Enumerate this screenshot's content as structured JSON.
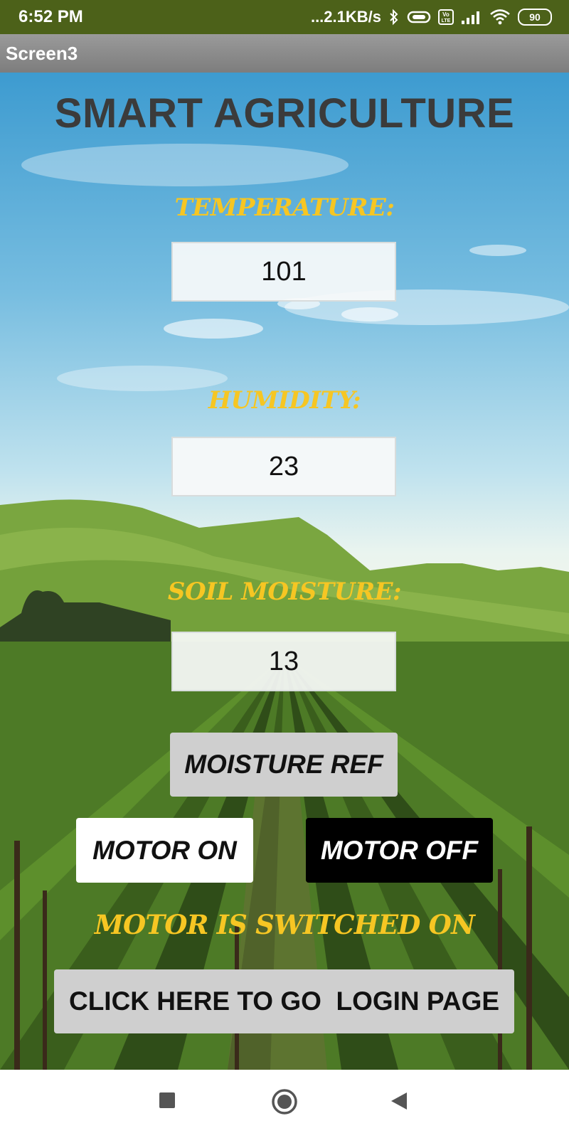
{
  "status_bar": {
    "time": "6:52 PM",
    "network_speed": "...2.1KB/s",
    "battery_level": "90",
    "icons": [
      "bluetooth-icon",
      "vibrate-icon",
      "volte-icon",
      "signal-icon",
      "wifi-icon",
      "battery-icon"
    ]
  },
  "title_bar": {
    "title": "Screen3"
  },
  "main": {
    "app_title": "SMART AGRICULTURE",
    "temperature": {
      "label": "TEMPERATURE:",
      "value": "101"
    },
    "humidity": {
      "label": "HUMIDITY:",
      "value": "23"
    },
    "soil_moisture": {
      "label": "SOIL MOISTURE:",
      "value": "13"
    },
    "moisture_ref_button": "MOISTURE REF",
    "motor_on_button": "MOTOR ON",
    "motor_off_button": "MOTOR OFF",
    "motor_status": "MOTOR IS SWITCHED ON",
    "login_button": "CLICK HERE TO GO  LOGIN PAGE"
  },
  "nav_bar": {
    "icons": [
      "recents-square-icon",
      "home-circle-icon",
      "back-triangle-icon"
    ]
  },
  "colors": {
    "status_bar_bg": "#4c6119",
    "label_yellow": "#f6c623",
    "title_text": "#3b3b3b",
    "button_gray": "#cfcfcf"
  }
}
